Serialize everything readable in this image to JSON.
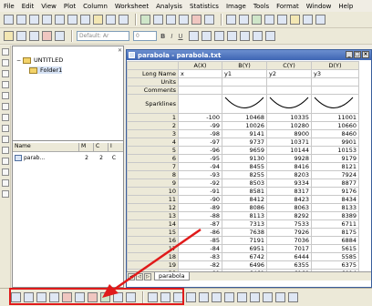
{
  "menu": [
    "File",
    "Edit",
    "View",
    "Plot",
    "Column",
    "Worksheet",
    "Analysis",
    "Statistics",
    "Image",
    "Tools",
    "Format",
    "Window",
    "Help"
  ],
  "format_toolbar": {
    "font_name": "Default: Ar",
    "font_size": "0",
    "bold": "B",
    "italic": "I",
    "underline": "U"
  },
  "explorer": {
    "root": "UNTITLED",
    "folder": "Folder1",
    "columns": [
      "Name",
      "M",
      "C",
      "I"
    ],
    "row": {
      "name": "parab...",
      "m": "2",
      "c": "2",
      "i": "C"
    }
  },
  "worksheet": {
    "title": "parabola - parabola.txt",
    "columns": [
      "A(X)",
      "B(Y)",
      "C(Y)",
      "D(Y)"
    ],
    "meta_rows": [
      {
        "label": "Long Name",
        "values": [
          "x",
          "y1",
          "y2",
          "y3"
        ]
      },
      {
        "label": "Units",
        "values": [
          "",
          "",
          "",
          ""
        ]
      },
      {
        "label": "Comments",
        "values": [
          "",
          "",
          "",
          ""
        ]
      }
    ],
    "sparkline_label": "Sparklines",
    "rows": [
      {
        "n": "1",
        "v": [
          "-100",
          "10468",
          "10335",
          "11001"
        ]
      },
      {
        "n": "2",
        "v": [
          "-99",
          "10026",
          "10280",
          "10660"
        ]
      },
      {
        "n": "3",
        "v": [
          "-98",
          "9141",
          "8900",
          "8460"
        ]
      },
      {
        "n": "4",
        "v": [
          "-97",
          "9737",
          "10371",
          "9901"
        ]
      },
      {
        "n": "5",
        "v": [
          "-96",
          "9659",
          "10144",
          "10153"
        ]
      },
      {
        "n": "6",
        "v": [
          "-95",
          "9130",
          "9928",
          "9179"
        ]
      },
      {
        "n": "7",
        "v": [
          "-94",
          "8455",
          "8416",
          "8121"
        ]
      },
      {
        "n": "8",
        "v": [
          "-93",
          "8255",
          "8203",
          "7924"
        ]
      },
      {
        "n": "9",
        "v": [
          "-92",
          "8503",
          "9334",
          "8877"
        ]
      },
      {
        "n": "10",
        "v": [
          "-91",
          "8581",
          "8317",
          "9176"
        ]
      },
      {
        "n": "11",
        "v": [
          "-90",
          "8412",
          "8423",
          "8434"
        ]
      },
      {
        "n": "12",
        "v": [
          "-89",
          "8086",
          "8063",
          "8133"
        ]
      },
      {
        "n": "13",
        "v": [
          "-88",
          "8113",
          "8292",
          "8389"
        ]
      },
      {
        "n": "14",
        "v": [
          "-87",
          "7313",
          "7533",
          "6711"
        ]
      },
      {
        "n": "15",
        "v": [
          "-86",
          "7638",
          "7926",
          "8175"
        ]
      },
      {
        "n": "16",
        "v": [
          "-85",
          "7191",
          "7036",
          "6884"
        ]
      },
      {
        "n": "17",
        "v": [
          "-84",
          "6951",
          "7017",
          "5615"
        ]
      },
      {
        "n": "18",
        "v": [
          "-83",
          "6742",
          "6444",
          "5585"
        ]
      },
      {
        "n": "19",
        "v": [
          "-82",
          "6496",
          "6355",
          "6375"
        ]
      },
      {
        "n": "20",
        "v": [
          "-81",
          "6461",
          "6169",
          "6014"
        ]
      }
    ],
    "sheet_tab": "parabola"
  },
  "colors": {
    "highlight": "#e01a1a",
    "title_bar": "#3e65b3"
  }
}
